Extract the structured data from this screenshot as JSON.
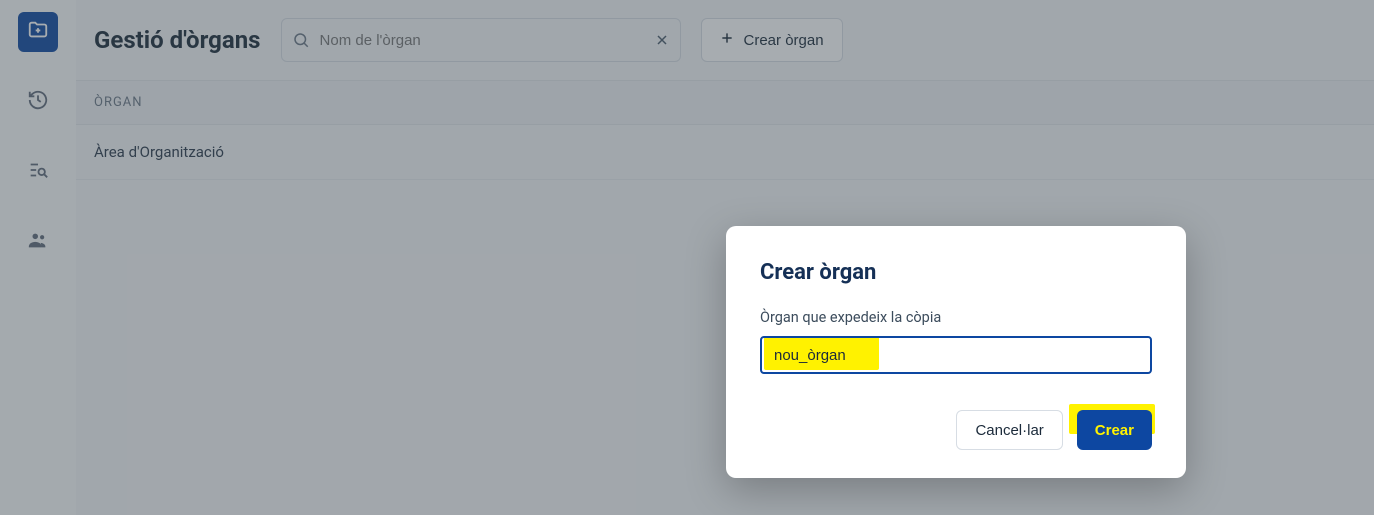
{
  "header": {
    "title": "Gestió d'òrgans",
    "search_placeholder": "Nom de l'òrgan",
    "search_value": "",
    "create_button": "Crear òrgan"
  },
  "sidebar": {
    "items": [
      {
        "name": "folder-add",
        "active": true
      },
      {
        "name": "history",
        "active": false
      },
      {
        "name": "search-list",
        "active": false
      },
      {
        "name": "people",
        "active": false
      }
    ]
  },
  "table": {
    "columns": [
      "ÒRGAN"
    ],
    "rows": [
      {
        "name": "Àrea d'Organització"
      }
    ]
  },
  "modal": {
    "title": "Crear òrgan",
    "field_label": "Òrgan que expedeix la còpia",
    "input_value": "nou_òrgan",
    "cancel_label": "Cancel·lar",
    "submit_label": "Crear"
  },
  "icons": {
    "folder_add": "folder-add-icon",
    "history": "history-icon",
    "search_list": "search-list-icon",
    "people": "people-icon",
    "search": "search-icon",
    "clear": "close-icon",
    "plus": "plus-icon"
  },
  "colors": {
    "accent": "#0d47a1",
    "highlight": "#fff200"
  }
}
